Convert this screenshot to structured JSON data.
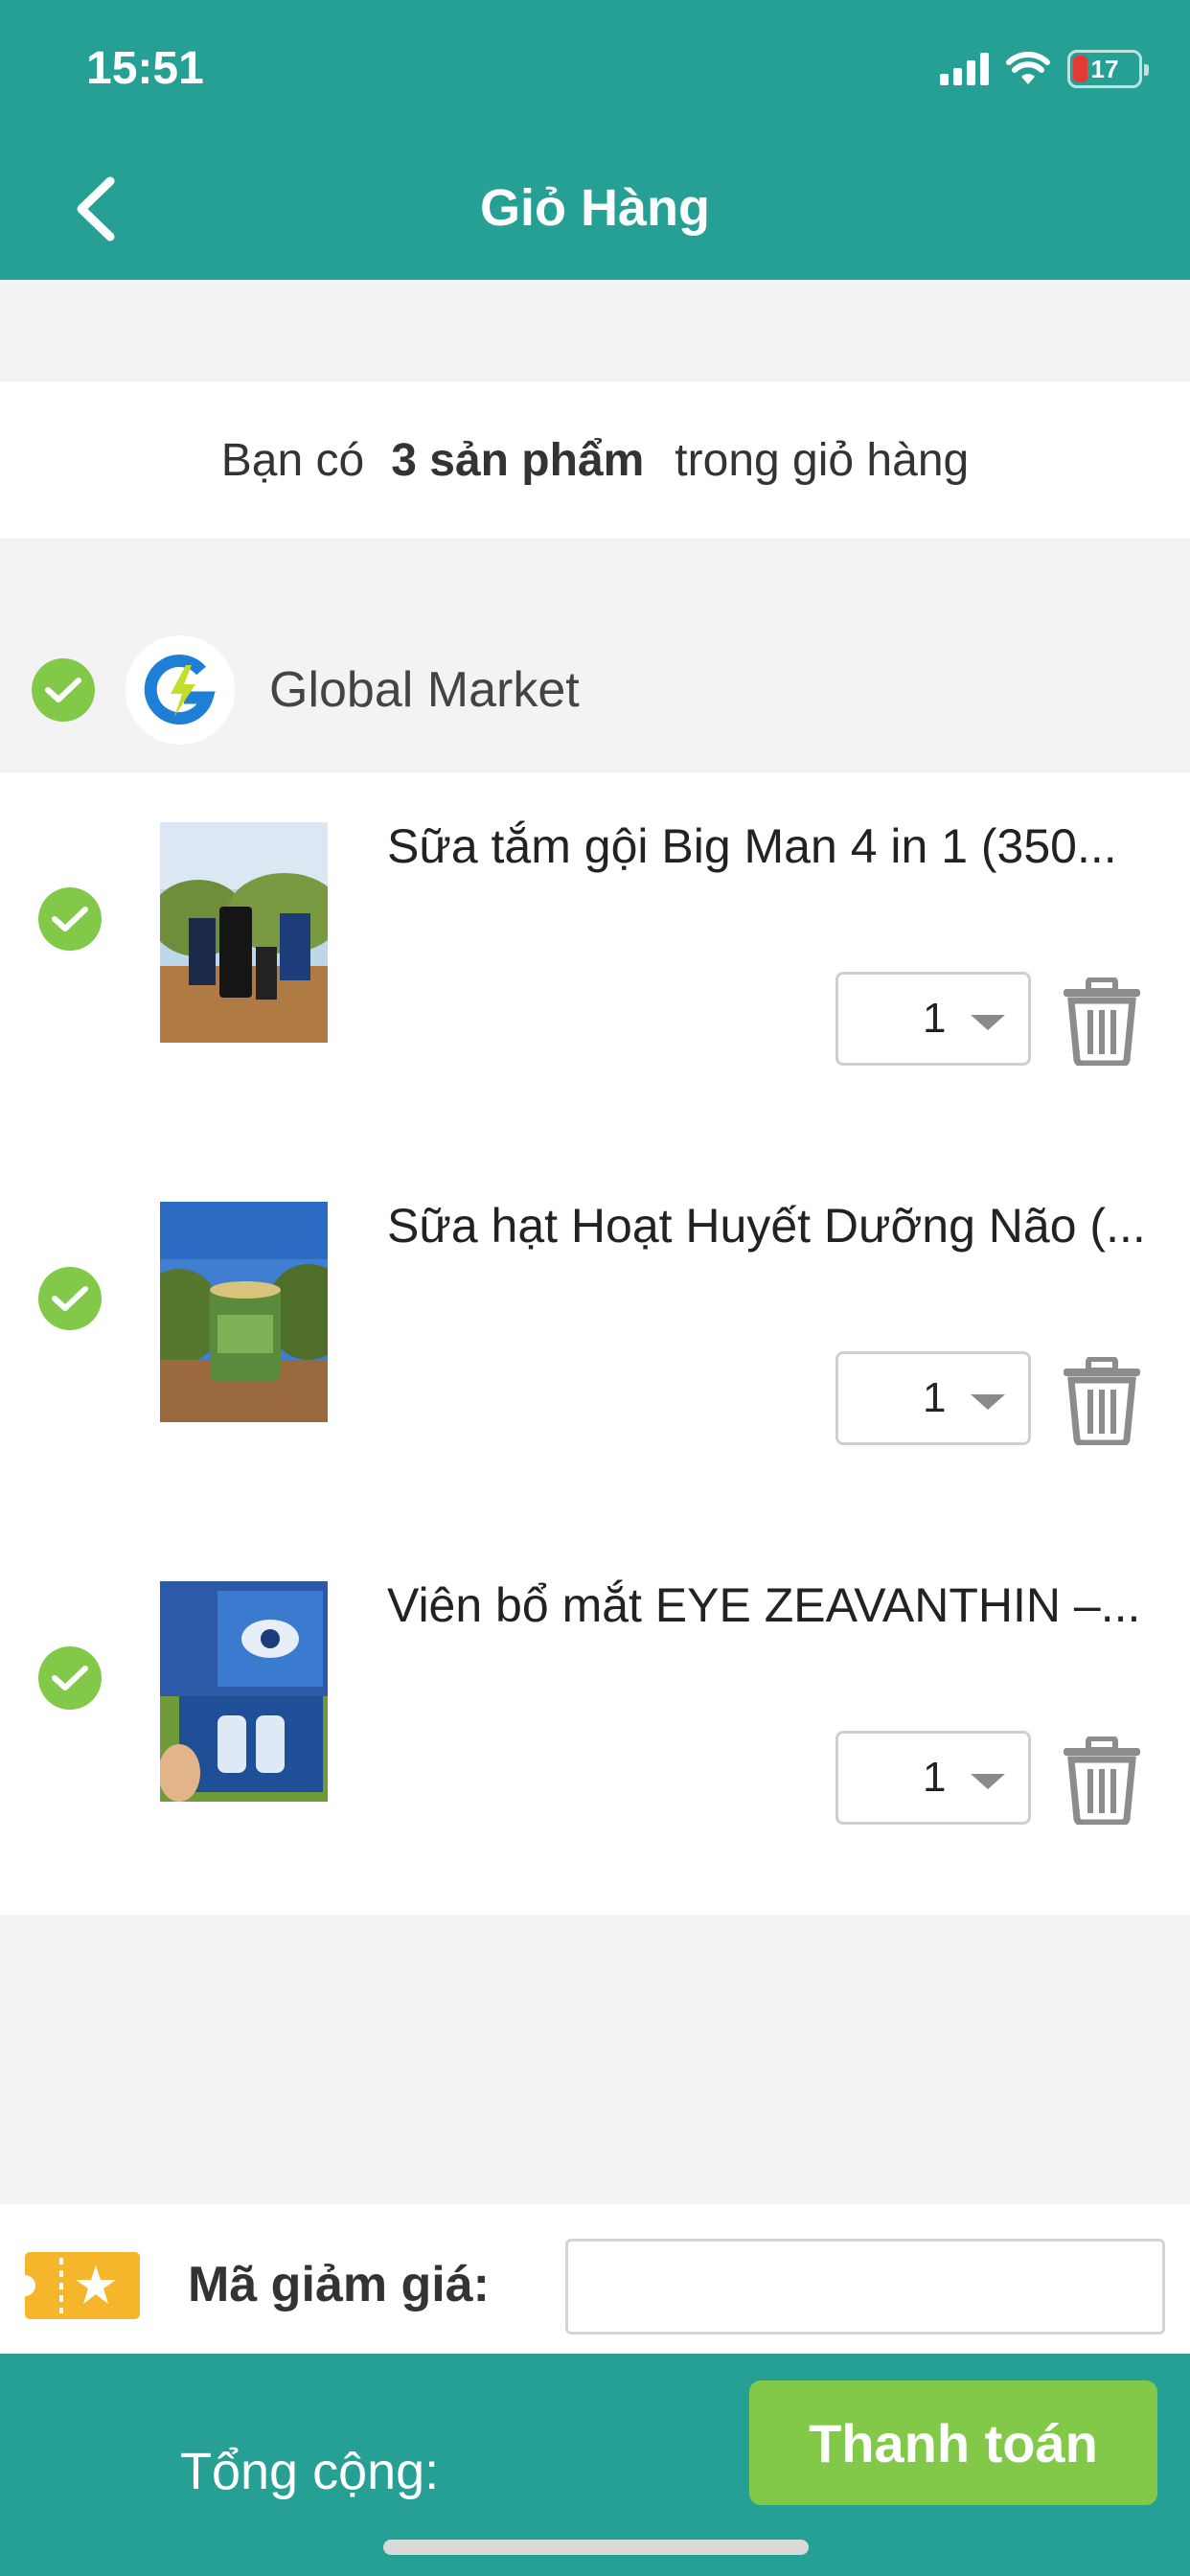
{
  "status": {
    "time": "15:51",
    "battery": "17"
  },
  "header": {
    "title": "Giỏ Hàng"
  },
  "summary": {
    "prefix": "Bạn có",
    "count": "3 sản phẩm",
    "suffix": "trong giỏ hàng"
  },
  "seller": {
    "name": "Global Market"
  },
  "items": [
    {
      "name": "Sữa tắm gội Big Man 4 in 1 (350...",
      "qty": "1"
    },
    {
      "name": "Sữa hạt Hoạt Huyết Dưỡng Não (...",
      "qty": "1"
    },
    {
      "name": "Viên bổ mắt EYE ZEAVANTHIN –...",
      "qty": "1"
    }
  ],
  "discount": {
    "label": "Mã giảm giá:",
    "value": "",
    "placeholder": ""
  },
  "footer": {
    "total_label": "Tổng cộng:",
    "checkout_label": "Thanh toán"
  },
  "colors": {
    "primary": "#26a094",
    "accent_green": "#82c94a",
    "ticket": "#f5b62c"
  }
}
